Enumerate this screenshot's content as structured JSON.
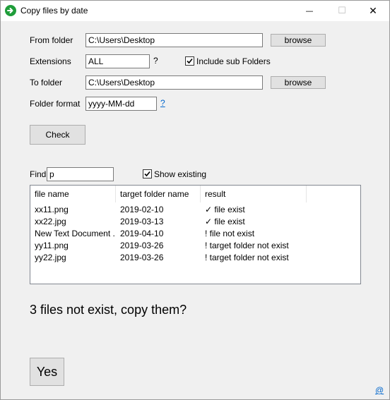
{
  "window": {
    "title": "Copy files by date",
    "minimize_glyph": "—",
    "maximize_glyph": "☐",
    "close_glyph": "✕"
  },
  "form": {
    "from_folder_label": "From folder",
    "from_folder_value": "C:\\Users\\Desktop",
    "browse_label": "browse",
    "extensions_label": "Extensions",
    "extensions_value": "ALL",
    "extensions_help": "?",
    "include_subfolders_label": "Include sub Folders",
    "include_subfolders_checked": true,
    "to_folder_label": "To folder",
    "to_folder_value": "C:\\Users\\Desktop",
    "folder_format_label": "Folder format",
    "folder_format_value": "yyyy-MM-dd",
    "folder_format_help": "?",
    "check_label": "Check"
  },
  "filter": {
    "find_label": "Find",
    "find_value": "p",
    "show_existing_label": "Show existing",
    "show_existing_checked": true
  },
  "results": {
    "columns": [
      "file name",
      "target folder name",
      "result"
    ],
    "rows": [
      [
        "xx11.png",
        "2019-02-10",
        "✓ file exist"
      ],
      [
        "xx22.jpg",
        "2019-03-13",
        "✓ file exist"
      ],
      [
        "New Text Document ...",
        "2019-04-10",
        "! file not exist"
      ],
      [
        "yy11.png",
        "2019-03-26",
        "! target folder not exist"
      ],
      [
        "yy22.jpg",
        "2019-03-26",
        "! target folder not exist"
      ]
    ]
  },
  "message": "3 files not exist, copy them?",
  "yes_label": "Yes",
  "about_link": "@",
  "colors": {
    "accent_link": "#0066cc",
    "app_icon": "#1f9d3a"
  }
}
